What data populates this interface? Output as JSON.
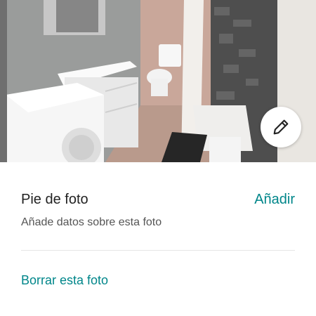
{
  "photo": {
    "subject": "bathroom-photo"
  },
  "edit": {
    "icon": "pencil-icon"
  },
  "caption": {
    "title": "Pie de foto",
    "add_label": "Añadir",
    "hint": "Añade datos sobre esta foto"
  },
  "actions": {
    "delete_label": "Borrar esta foto"
  },
  "colors": {
    "accent": "#00868a",
    "text_primary": "#222222",
    "text_secondary": "#555555",
    "divider": "#e6e6e6"
  }
}
